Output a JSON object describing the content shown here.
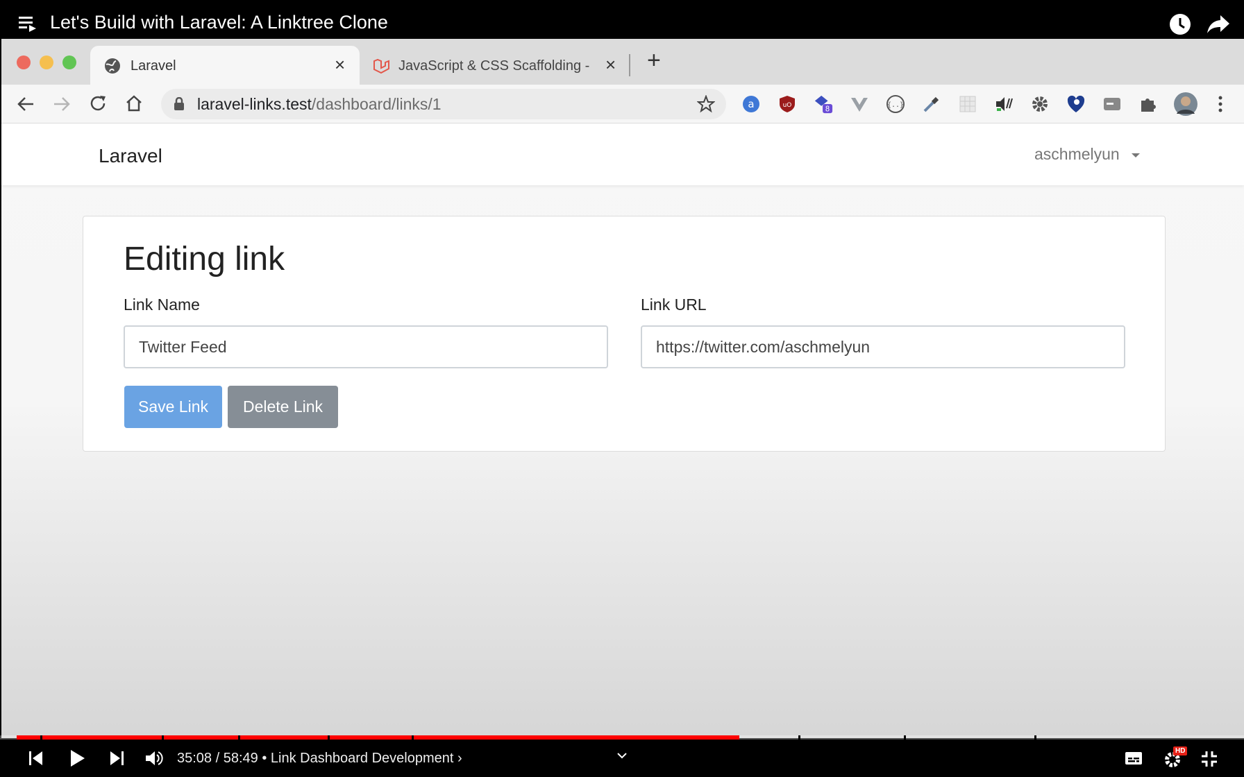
{
  "video": {
    "title": "Let's Build with Laravel: A Linktree Clone",
    "time": "35:08 / 58:49",
    "separator": "•",
    "chapter": "Link Dashboard Development",
    "chapter_arrow": "›",
    "progress": 0.597,
    "hd_badge": "HD"
  },
  "browser": {
    "tabs": [
      {
        "label": "Laravel",
        "active": true,
        "icon": "globe-icon"
      },
      {
        "label": "JavaScript & CSS Scaffolding -",
        "active": false,
        "icon": "laravel-logo-icon"
      }
    ],
    "new_tab": "+",
    "url_host": "laravel-links.test",
    "url_path": "/dashboard/links/1",
    "extension_badge": "8"
  },
  "app": {
    "brand": "Laravel",
    "user": "aschmelyun",
    "card_title": "Editing link",
    "link_name_label": "Link Name",
    "link_name_value": "Twitter Feed",
    "link_url_label": "Link URL",
    "link_url_value": "https://twitter.com/aschmelyun",
    "save_label": "Save Link",
    "delete_label": "Delete Link"
  },
  "colors": {
    "save_button": "#6aa3e3",
    "delete_button": "#868e96",
    "progress_played": "#ff0000"
  }
}
